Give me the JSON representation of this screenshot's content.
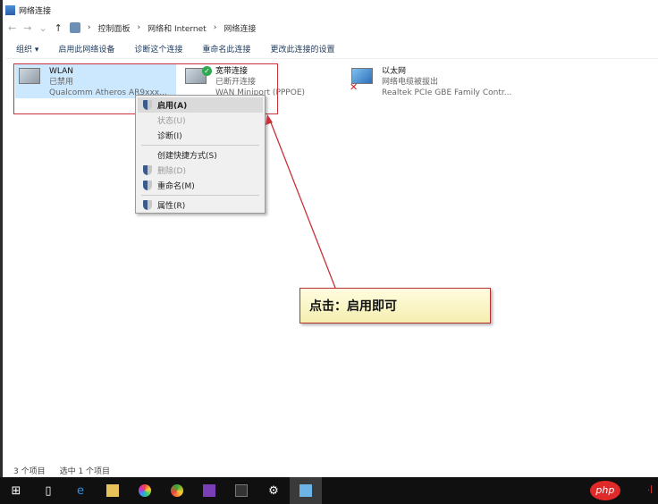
{
  "window": {
    "title": "网络连接"
  },
  "address": {
    "crumbs": [
      "控制面板",
      "网络和 Internet",
      "网络连接"
    ]
  },
  "toolbar": {
    "organize": "组织 ▾",
    "items": [
      "启用此网络设备",
      "诊断这个连接",
      "重命名此连接",
      "更改此连接的设置"
    ]
  },
  "connections": [
    {
      "name": "WLAN",
      "status": "已禁用",
      "device": "Qualcomm Atheros AR9xxx..."
    },
    {
      "name": "宽带连接",
      "status": "已断开连接",
      "device": "WAN Miniport (PPPOE)"
    },
    {
      "name": "以太网",
      "status": "网络电缆被拔出",
      "device": "Realtek PCIe GBE Family Contr..."
    }
  ],
  "context_menu": {
    "items": [
      "启用(A)",
      "状态(U)",
      "诊断(I)",
      "创建快捷方式(S)",
      "删除(D)",
      "重命名(M)",
      "属性(R)"
    ]
  },
  "callout": "点击：启用即可",
  "status": {
    "count": "3 个项目",
    "selected": "选中 1 个项目"
  },
  "taskbar": {
    "watermark": "php"
  },
  "colors": {
    "annotation": "#c8323a",
    "selection": "#cce8ff"
  }
}
